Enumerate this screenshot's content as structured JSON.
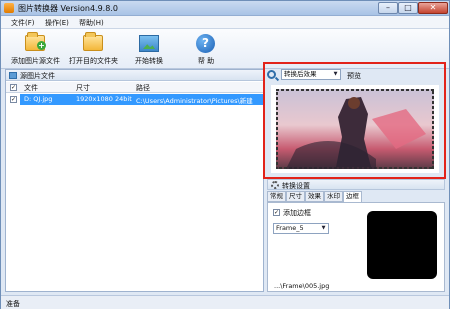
{
  "titlebar": {
    "title": "图片转换器 Version4.9.8.0",
    "minimize": "–",
    "maximize": "□",
    "close": "✕"
  },
  "menu": {
    "file": "文件(F)",
    "operate": "操作(E)",
    "help": "帮助(H)"
  },
  "toolbar": {
    "add_source": "添加图片源文件",
    "open_target": "打开目的文件夹",
    "start_convert": "开始转换",
    "help": "帮 助"
  },
  "file_panel": {
    "title": "源图片文件",
    "columns": {
      "file": "文件",
      "size": "尺寸",
      "path": "路径"
    },
    "rows": [
      {
        "file": "D: QJ.jpg",
        "size": "1920x1080 24bit",
        "path": "C:\\Users\\Administrator\\Pictures\\新建"
      }
    ]
  },
  "preview": {
    "mode": "转换后效果",
    "label": "预览"
  },
  "settings": {
    "title": "转换设置",
    "tabs": [
      "常规",
      "尺寸",
      "效果",
      "水印",
      "边框"
    ],
    "active_tab": "边框",
    "add_border_label": "添加边框",
    "add_border_checked": true,
    "frame_select": "Frame_5",
    "frame_path": "...\\Frame\\005.jpg"
  },
  "status": {
    "text": "准备"
  }
}
